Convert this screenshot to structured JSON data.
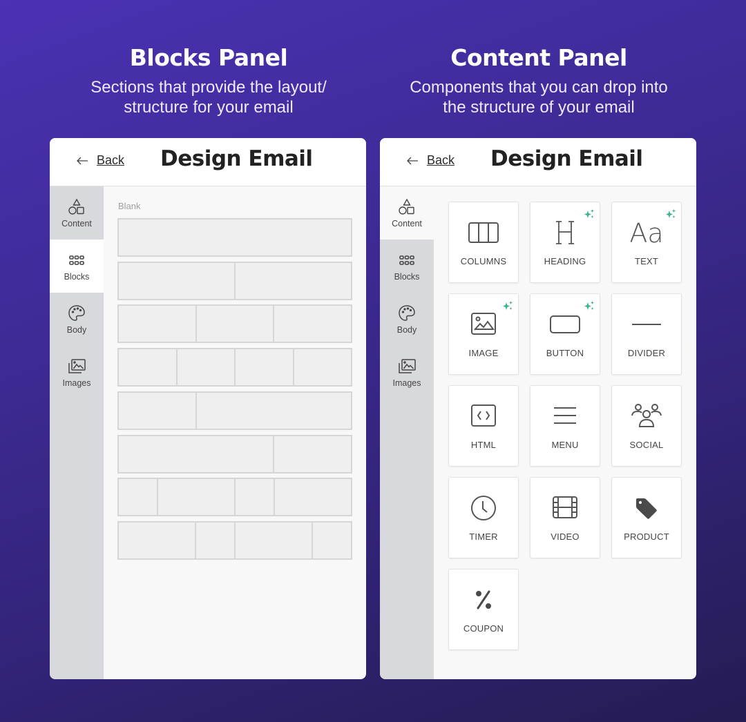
{
  "left_column": {
    "title": "Blocks Panel",
    "subtitle_line1": "Sections that provide the layout/",
    "subtitle_line2": "structure for your email"
  },
  "right_column": {
    "title": "Content Panel",
    "subtitle_line1": "Components that you can drop into",
    "subtitle_line2": "the structure of your email"
  },
  "panel": {
    "back_label": "Back",
    "title": "Design Email"
  },
  "sidebar": {
    "items": [
      {
        "label": "Content",
        "icon": "shapes-icon"
      },
      {
        "label": "Blocks",
        "icon": "grid-dots-icon"
      },
      {
        "label": "Body",
        "icon": "palette-icon"
      },
      {
        "label": "Images",
        "icon": "images-icon"
      }
    ]
  },
  "blocks_panel": {
    "active_tab": "Blocks",
    "section_label": "Blank",
    "layouts": [
      [
        12
      ],
      [
        6,
        6
      ],
      [
        4,
        4,
        4
      ],
      [
        3,
        3,
        3,
        3
      ],
      [
        4,
        8
      ],
      [
        8,
        4
      ],
      [
        2,
        4,
        2,
        4
      ],
      [
        4,
        2,
        4,
        2
      ]
    ]
  },
  "content_panel": {
    "active_tab": "Content",
    "accent_color": "#3fb38a",
    "tiles": [
      {
        "label": "COLUMNS",
        "icon": "columns-icon",
        "ai": false
      },
      {
        "label": "HEADING",
        "icon": "heading-icon",
        "ai": true
      },
      {
        "label": "TEXT",
        "icon": "text-icon",
        "ai": true
      },
      {
        "label": "IMAGE",
        "icon": "image-icon",
        "ai": true
      },
      {
        "label": "BUTTON",
        "icon": "button-icon",
        "ai": true
      },
      {
        "label": "DIVIDER",
        "icon": "divider-icon",
        "ai": false
      },
      {
        "label": "HTML",
        "icon": "code-icon",
        "ai": false
      },
      {
        "label": "MENU",
        "icon": "menu-icon",
        "ai": false
      },
      {
        "label": "SOCIAL",
        "icon": "people-icon",
        "ai": false
      },
      {
        "label": "TIMER",
        "icon": "clock-icon",
        "ai": false
      },
      {
        "label": "VIDEO",
        "icon": "film-icon",
        "ai": false
      },
      {
        "label": "PRODUCT",
        "icon": "tag-icon",
        "ai": false
      },
      {
        "label": "COUPON",
        "icon": "percent-icon",
        "ai": false
      }
    ]
  }
}
